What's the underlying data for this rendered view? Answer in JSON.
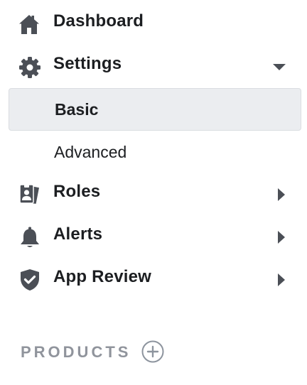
{
  "nav": {
    "items": [
      {
        "label": "Dashboard",
        "icon": "home-icon"
      },
      {
        "label": "Settings",
        "icon": "gear-icon",
        "expanded": true
      },
      {
        "label": "Roles",
        "icon": "id-badge-icon"
      },
      {
        "label": "Alerts",
        "icon": "bell-icon"
      },
      {
        "label": "App Review",
        "icon": "shield-check-icon"
      }
    ],
    "settings_submenu": [
      {
        "label": "Basic",
        "selected": true
      },
      {
        "label": "Advanced",
        "selected": false
      }
    ]
  },
  "products": {
    "title": "PRODUCTS",
    "add_icon": "plus-circle-icon"
  },
  "colors": {
    "text": "#1c1e21",
    "icon": "#4b4f56",
    "muted": "#90949c",
    "selected_bg": "#ebedf0"
  }
}
